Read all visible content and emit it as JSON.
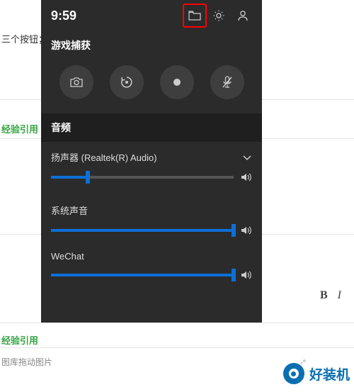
{
  "bg": {
    "text1": "三个按钮；就开始录屏了",
    "text2": "经验引用",
    "text3": "经验引用",
    "text4": "图库拖动图片"
  },
  "topbar": {
    "time": "9:59"
  },
  "capture": {
    "title": "游戏捕获"
  },
  "audio": {
    "header": "音频",
    "device": {
      "label": "扬声器 (Realtek(R) Audio)",
      "level": 20
    },
    "system": {
      "label": "系统声音",
      "level": 100
    },
    "wechat": {
      "label": "WeChat",
      "level": 100
    }
  },
  "logo": {
    "text": "好装机"
  },
  "toolbar": {
    "bold": "B",
    "italic": "I"
  }
}
